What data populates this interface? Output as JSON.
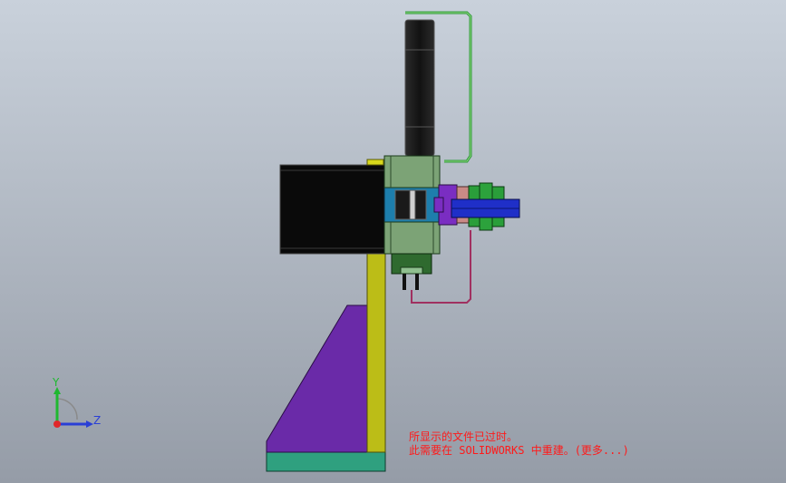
{
  "colors": {
    "background_top": "#c9d1db",
    "background_bottom": "#959ca7",
    "axis_y": "#1fb830",
    "axis_x": "#e0262b",
    "axis_z": "#2a3fd6",
    "warning_text": "#ff1a1a"
  },
  "triad": {
    "y_label": "Y",
    "z_label": "Z"
  },
  "warning": {
    "line1": "所显示的文件已过时。",
    "line2_prefix": "此需要在 SOLIDWORKS 中重建。",
    "more_link": "(更多...)"
  }
}
